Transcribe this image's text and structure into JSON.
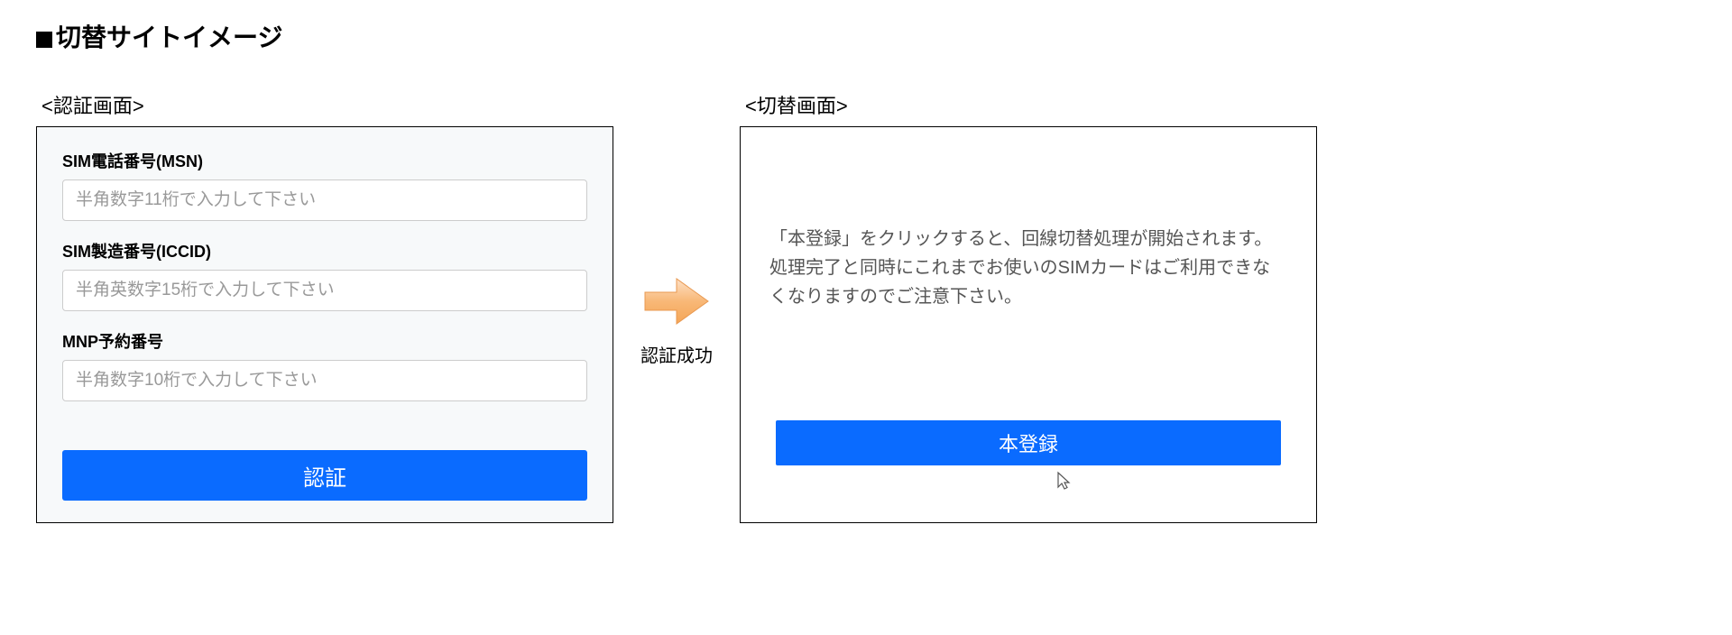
{
  "page": {
    "title": "切替サイトイメージ"
  },
  "left_panel": {
    "title": "<認証画面>",
    "fields": {
      "msn": {
        "label": "SIM電話番号(MSN)",
        "placeholder": "半角数字11桁で入力して下さい"
      },
      "iccid": {
        "label": "SIM製造番号(ICCID)",
        "placeholder": "半角英数字15桁で入力して下さい"
      },
      "mnp": {
        "label": "MNP予約番号",
        "placeholder": "半角数字10桁で入力して下さい"
      }
    },
    "submit_label": "認証"
  },
  "arrow": {
    "label": "認証成功"
  },
  "right_panel": {
    "title": "<切替画面>",
    "info_text": "「本登録」をクリックすると、回線切替処理が開始されます。処理完了と同時にこれまでお使いのSIMカードはご利用できなくなりますのでご注意下さい。",
    "register_label": "本登録"
  }
}
